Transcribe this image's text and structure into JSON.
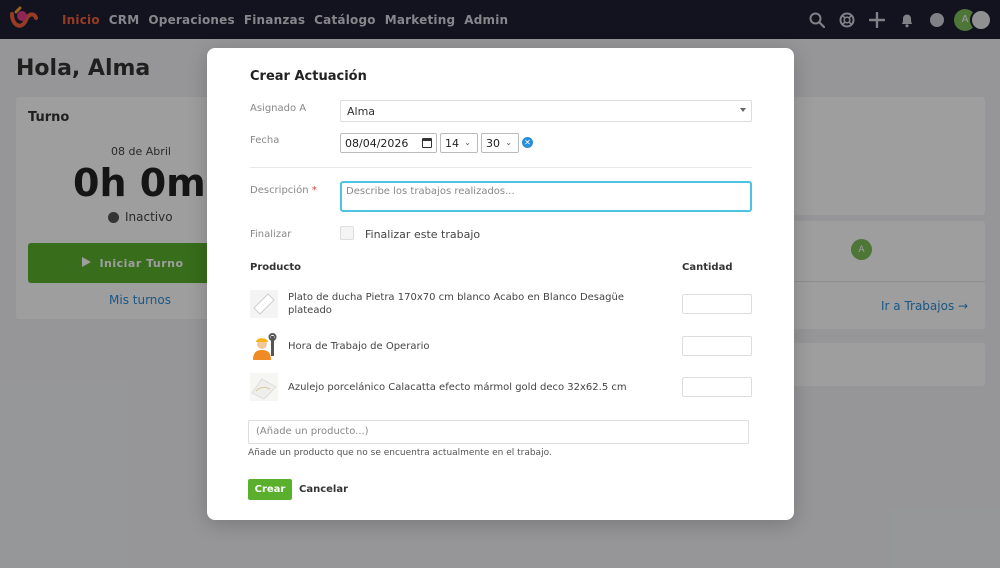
{
  "nav": {
    "items": [
      "Inicio",
      "CRM",
      "Operaciones",
      "Finanzas",
      "Catálogo",
      "Marketing",
      "Admin"
    ],
    "active_index": 0,
    "avatar_initial": "A",
    "icons": [
      "search-icon",
      "help-icon",
      "plus-icon",
      "bell-icon",
      "status-icon"
    ]
  },
  "page": {
    "greeting": "Hola, Alma"
  },
  "turno": {
    "title": "Turno",
    "date": "08 de Abril",
    "time": "0h 0m",
    "status": "Inactivo",
    "start_button": "Iniciar Turno",
    "my_shifts_link": "Mis turnos"
  },
  "right_panel": {
    "avatar_initial": "A",
    "jobs_link": "Ir a Trabajos →"
  },
  "modal": {
    "title": "Crear Actuación",
    "assigned_label": "Asignado A",
    "assigned_value": "Alma",
    "date_label": "Fecha",
    "date_value": "08/04/2026",
    "hour_value": "14",
    "minute_value": "30",
    "description_label": "Descripción",
    "description_placeholder": "Describe los trabajos realizados...",
    "finalize_label": "Finalizar",
    "finalize_checkbox_label": "Finalizar este trabajo",
    "product_header": "Producto",
    "quantity_header": "Cantidad",
    "products": [
      {
        "name": "Plato de ducha Pietra 170x70 cm blanco Acabo en Blanco Desagüe plateado",
        "quantity": ""
      },
      {
        "name": "Hora de Trabajo de Operario",
        "quantity": ""
      },
      {
        "name": "Azulejo porcelánico Calacatta efecto mármol gold deco 32x62.5 cm",
        "quantity": ""
      }
    ],
    "add_product_placeholder": "(Añade un producto...)",
    "add_product_help": "Añade un producto que no se encuentra actualmente en el trabajo.",
    "create_button": "Crear",
    "cancel_button": "Cancelar"
  },
  "colors": {
    "nav_bg": "#1f1d32",
    "nav_active": "#f4623a",
    "primary_green": "#5ab02c",
    "link_blue": "#2a8ed8",
    "focus_cyan": "#4cc3e0"
  }
}
